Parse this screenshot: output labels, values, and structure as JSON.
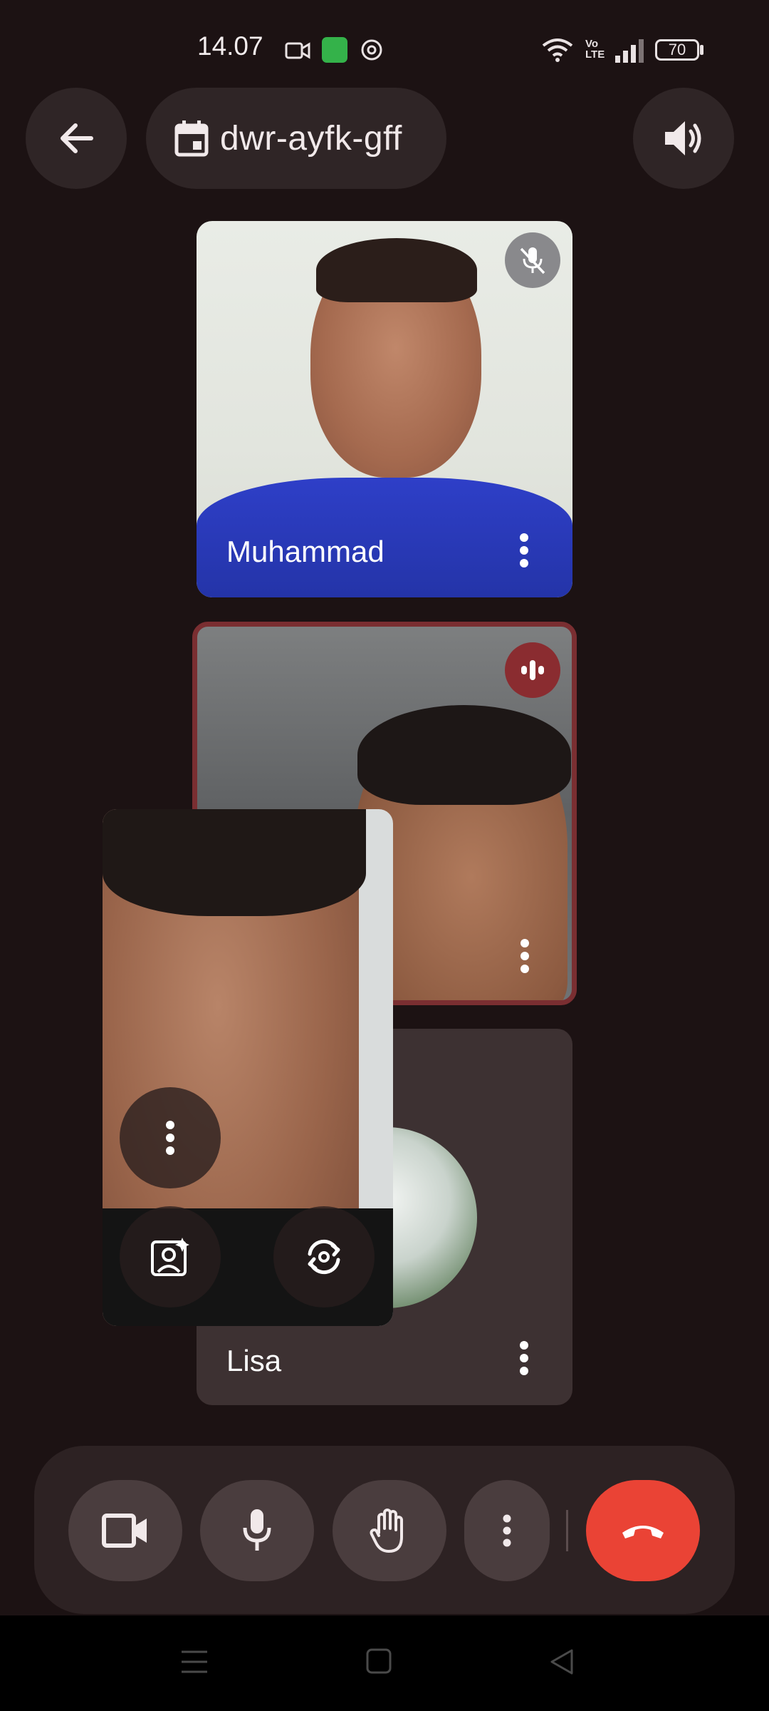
{
  "status_bar": {
    "time": "14.07",
    "battery": "70",
    "network_label_top": "Vo",
    "network_label_bottom": "LTE"
  },
  "top_bar": {
    "back_icon": "arrow-back-icon",
    "meeting_code": "dwr-ayfk-gff",
    "calendar_icon": "calendar-icon",
    "speaker_icon": "volume-up-icon"
  },
  "participants": [
    {
      "name": "Muhammad",
      "muted": true,
      "speaking": false
    },
    {
      "name": "",
      "muted": false,
      "speaking": true
    },
    {
      "name": "Lisa",
      "muted": false,
      "speaking": false
    }
  ],
  "self_view": {
    "more_icon": "more-vert-icon",
    "effects_icon": "visual-effects-icon",
    "switch_camera_icon": "switch-camera-icon"
  },
  "controls": {
    "camera_icon": "videocam-icon",
    "mic_icon": "mic-icon",
    "raise_hand_icon": "hand-icon",
    "more_icon": "more-vert-icon",
    "hangup_icon": "call-end-icon",
    "hangup_color": "#ea4335"
  },
  "colors": {
    "background": "#1c1213",
    "speaking_border": "#7a2e31",
    "speaking_badge": "#8a2c30"
  }
}
